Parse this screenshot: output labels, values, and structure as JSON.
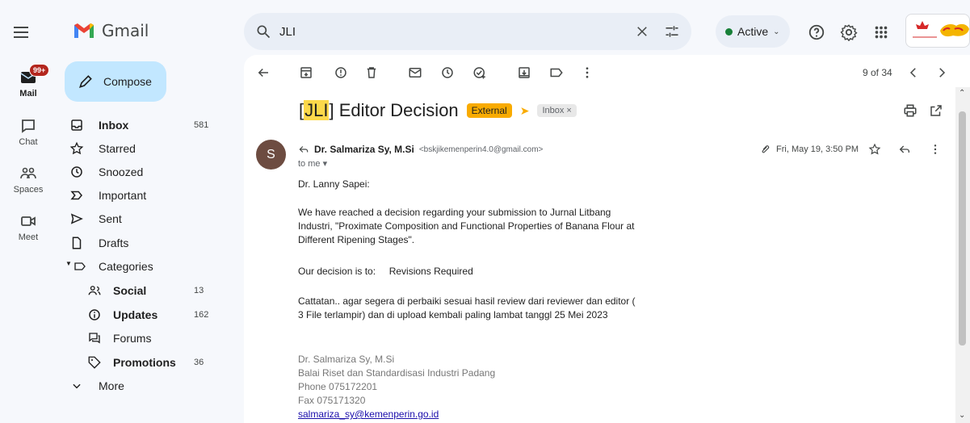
{
  "app": {
    "name": "Gmail"
  },
  "search": {
    "query": "JLI"
  },
  "status": {
    "label": "Active"
  },
  "rail": [
    {
      "label": "Mail",
      "badge": "99+"
    },
    {
      "label": "Chat"
    },
    {
      "label": "Spaces"
    },
    {
      "label": "Meet"
    }
  ],
  "compose": {
    "label": "Compose"
  },
  "nav": {
    "inbox": {
      "label": "Inbox",
      "count": "581"
    },
    "starred": {
      "label": "Starred"
    },
    "snoozed": {
      "label": "Snoozed"
    },
    "important": {
      "label": "Important"
    },
    "sent": {
      "label": "Sent"
    },
    "drafts": {
      "label": "Drafts"
    },
    "categories": {
      "label": "Categories"
    },
    "social": {
      "label": "Social",
      "count": "13"
    },
    "updates": {
      "label": "Updates",
      "count": "162"
    },
    "forums": {
      "label": "Forums"
    },
    "promotions": {
      "label": "Promotions",
      "count": "36"
    },
    "more": {
      "label": "More"
    }
  },
  "toolbar": {
    "pager": "9 of 34"
  },
  "email": {
    "subject_prefix": "[",
    "subject_highlight": "JLI",
    "subject_rest": "] Editor Decision",
    "external_label": "External",
    "inbox_chip": "Inbox ×",
    "sender_initial": "S",
    "sender_name": "Dr. Salmariza Sy, M.Si",
    "sender_email": "<bskjikemenperin4.0@gmail.com>",
    "to": "to me ▾",
    "date": "Fri, May 19, 3:50 PM",
    "greeting": "Dr. Lanny Sapei:",
    "para1": "We have reached a decision regarding your submission to Jurnal Litbang Industri, \"Proximate Composition and Functional Properties of Banana Flour at Different Ripening Stages\".",
    "decision": "Our decision is to:     Revisions Required",
    "para2": "Cattatan.. agar segera di perbaiki sesuai hasil review dari reviewer dan editor ( 3 File terlampir) dan di upload kembali paling lambat tanggl 25 Mei 2023",
    "sig_name": "Dr. Salmariza Sy, M.Si",
    "sig_org": "Balai Riset dan Standardisasi Industri Padang",
    "sig_phone": "Phone 075172201",
    "sig_fax": "Fax 075171320",
    "sig_email": "salmariza_sy@kemenperin.go.id"
  },
  "colors": {
    "accent": "#c2e7ff",
    "external": "#f9ab00",
    "highlight": "#fcd84a",
    "active": "#188038"
  }
}
